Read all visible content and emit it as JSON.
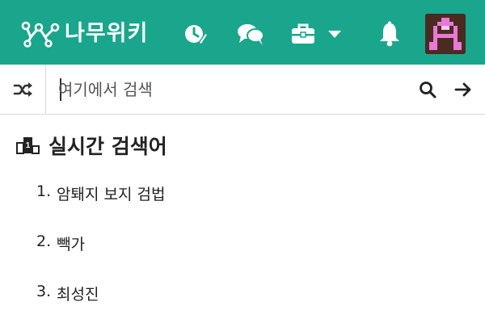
{
  "brand": {
    "name": "나무위키",
    "primary_color": "#1aa68c"
  },
  "header": {
    "nav": [
      {
        "name": "recent-changes",
        "icon": "compass-pencil-icon"
      },
      {
        "name": "discussion",
        "icon": "speech-bubbles-icon"
      },
      {
        "name": "tools",
        "icon": "toolbox-icon",
        "has_dropdown": true
      },
      {
        "name": "notifications",
        "icon": "bell-icon"
      },
      {
        "name": "user",
        "icon": "pixel-avatar"
      }
    ]
  },
  "search": {
    "placeholder": "여기에서 검색",
    "value": "",
    "random_icon": "shuffle-icon",
    "search_icon": "magnifier-icon",
    "go_icon": "arrow-right-icon"
  },
  "live_search": {
    "title": "실시간 검색어",
    "icon": "podium-icon",
    "podium_number": "1",
    "items": [
      {
        "rank": "1.",
        "label": "암퇘지 보지 검법"
      },
      {
        "rank": "2.",
        "label": "빽가"
      },
      {
        "rank": "3.",
        "label": "최성진"
      }
    ]
  }
}
